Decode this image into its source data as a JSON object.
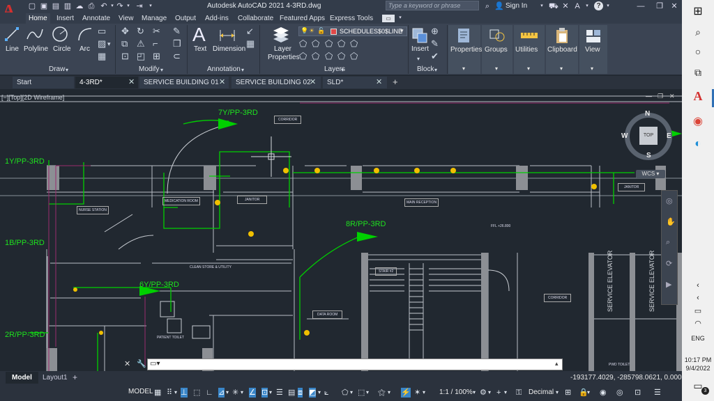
{
  "window": {
    "title": "Autodesk AutoCAD 2021    4-3RD.dwg",
    "search_placeholder": "Type a keyword or phrase",
    "sign_in": "Sign In",
    "help": "?"
  },
  "ribbon_tabs": [
    "Home",
    "Insert",
    "Annotate",
    "View",
    "Manage",
    "Output",
    "Add-ins",
    "Collaborate",
    "Featured Apps",
    "Express Tools"
  ],
  "ribbon": {
    "draw": {
      "line": "Line",
      "polyline": "Polyline",
      "circle": "Circle",
      "arc": "Arc",
      "group": "Draw"
    },
    "modify": {
      "group": "Modify"
    },
    "annotation": {
      "text": "Text",
      "dimension": "Dimension",
      "group": "Annotation"
    },
    "layers": {
      "layer_properties_1": "Layer",
      "layer_properties_2": "Properties",
      "current_layer": "SCHEDULES$0$LINE",
      "group": "Layers"
    },
    "block": {
      "insert": "Insert",
      "group": "Block"
    },
    "properties": "Properties",
    "groups": "Groups",
    "utilities": "Utilities",
    "clipboard": "Clipboard",
    "view": "View"
  },
  "doc_tabs": [
    "Start",
    "4-3RD*",
    "SERVICE BUILDING 01 (1)*",
    "SERVICE BUILDING 02 (1)*",
    "SLD*"
  ],
  "viewport_label": "[−][Top][2D Wireframe]",
  "viewcube": {
    "n": "N",
    "s": "S",
    "e": "E",
    "w": "W",
    "top": "TOP",
    "wcs": "WCS"
  },
  "drawing_labels": [
    "7Y/PP-3RD",
    "1Y/PP-3RD",
    "1B/PP-3RD",
    "8R/PP-3RD",
    "6Y/PP-3RD",
    "2R/PP-3RD"
  ],
  "rooms": {
    "corridor": "CORRIDOR",
    "medication_room": "MEDICATION ROOM",
    "janitor": "JANITOR",
    "nurse_station": "NURSE STATION",
    "main_reception": "MAIN RECEPTION",
    "clean_store": "CLEAN STORE & UTILITY",
    "data_room": "DATA ROOM",
    "stair": "STAIR #2",
    "service_elevator": "SERVICE ELEVATOR",
    "patient_toilet": "PATIENT TOILET",
    "pwd_toilet": "PWD TOILET",
    "ffl": "FFL +26.800"
  },
  "layout_tabs": [
    "Model",
    "Layout1",
    "+"
  ],
  "status": {
    "coords": "-193177.4029, -285798.0621, 0.0000",
    "model": "MODEL",
    "scale": "1:1 / 100%",
    "units": "Decimal"
  },
  "taskbar": {
    "lang": "ENG",
    "time": "10:17 PM",
    "date": "9/4/2022",
    "notifications": "3"
  }
}
